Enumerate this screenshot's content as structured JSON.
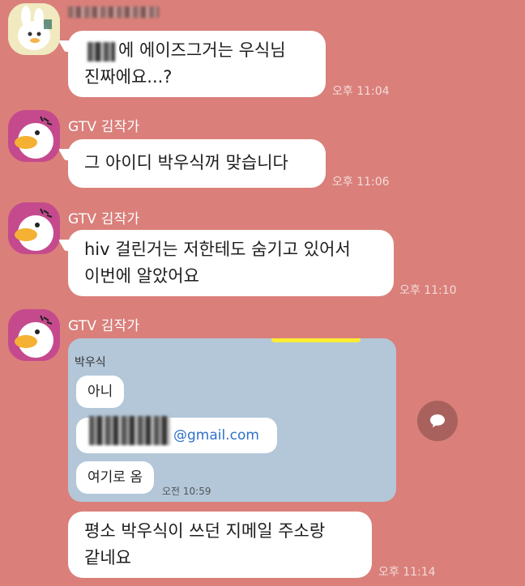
{
  "messages": {
    "m1": {
      "sender": "친구",
      "text_line1": "에 에이즈그거는 우식님",
      "text_line2": "진짜에요...?",
      "time": "오후 11:04"
    },
    "m2": {
      "sender": "GTV 김작가",
      "text": "그 아이디 박우식꺼 맞습니다",
      "time": "오후 11:06"
    },
    "m3": {
      "sender": "GTV 김작가",
      "text_line1": "hiv 걸린거는 저한테도 숨기고 있어서",
      "text_line2": "이번에 알았어요",
      "time": "오후 11:10"
    },
    "m4": {
      "sender": "GTV 김작가",
      "screenshot": {
        "sender": "박우식",
        "bubble1": "아니",
        "email": "@gmail.com",
        "bubble3": "여기로 옴",
        "time": "오전 10:59"
      }
    },
    "m5": {
      "text_line1": "평소 박우식이 쓰던 지메일 주소랑",
      "text_line2": "같네요",
      "time": "오후 11:14"
    }
  },
  "colors": {
    "background": "#da7f7a",
    "bubble": "#ffffff",
    "avatar_bg": "#c54a8d",
    "screenshot_bg": "#b3c7d9"
  },
  "icons": {
    "avatar_duck": "duck-avatar-icon",
    "avatar_other": "bunny-avatar-icon",
    "fab": "chat-bubble-icon"
  }
}
